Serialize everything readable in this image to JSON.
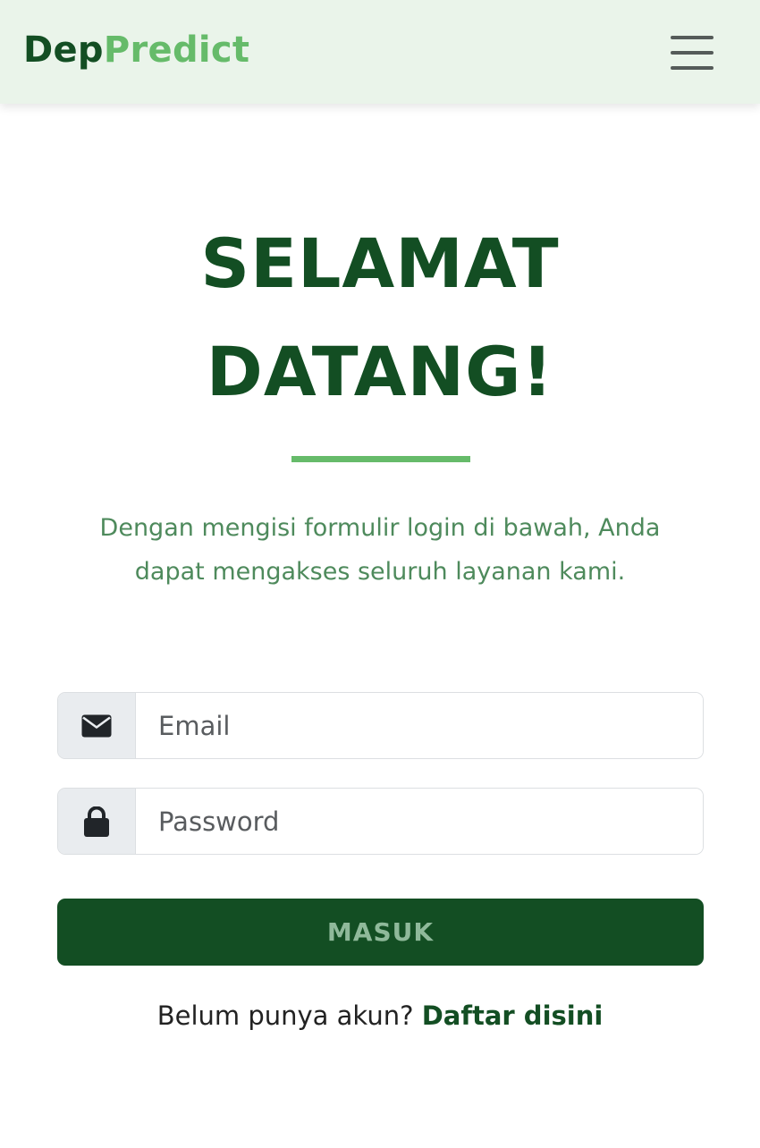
{
  "navbar": {
    "brand_part1": "Dep",
    "brand_part2": "Predict",
    "menu_icon": "hamburger-menu-icon"
  },
  "hero": {
    "title_line1": "SELAMAT",
    "title_line2": "DATANG!",
    "subtitle": "Dengan mengisi formulir login di bawah, Anda dapat mengakses seluruh layanan kami."
  },
  "form": {
    "email": {
      "icon": "envelope-icon",
      "placeholder": "Email",
      "value": ""
    },
    "password": {
      "icon": "lock-icon",
      "placeholder": "Password",
      "value": ""
    },
    "submit_label": "MASUK"
  },
  "register": {
    "prompt": "Belum punya akun?",
    "link_label": "Daftar disini"
  },
  "colors": {
    "navbar_bg": "#eaf4ea",
    "primary_dark_green": "#134e23",
    "accent_green": "#66bb6a",
    "subtitle_green": "#4e8a5c",
    "button_text": "#8fb99a"
  }
}
